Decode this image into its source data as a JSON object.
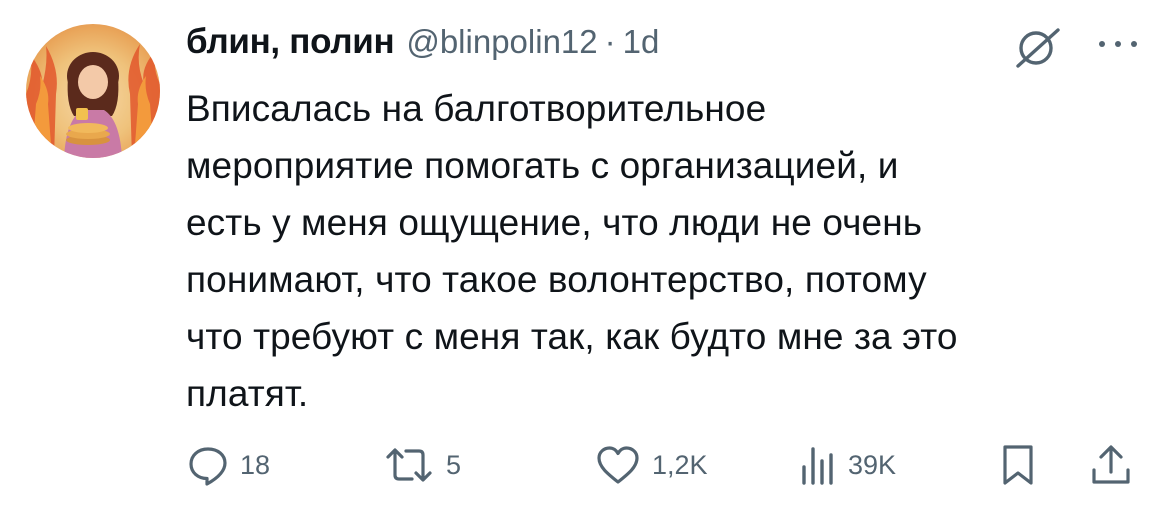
{
  "tweet": {
    "author": {
      "display_name": "блин, полин",
      "handle": "@blinpolin12",
      "avatar_icon": "avatar-illustration"
    },
    "separator": "·",
    "timestamp": "1d",
    "text": "Вписалась на балготворительное\nмероприятие помогать с организацией, и\nесть у меня ощущение, что люди не очень\nпонимают, что такое волонтерство, потому\nчто требуют с меня так, как будто мне за это\nплатят.",
    "actions": {
      "reply": {
        "icon": "reply-icon",
        "count": "18"
      },
      "retweet": {
        "icon": "retweet-icon",
        "count": "5"
      },
      "like": {
        "icon": "heart-icon",
        "count": "1,2K"
      },
      "views": {
        "icon": "views-icon",
        "count": "39K"
      },
      "bookmark": {
        "icon": "bookmark-icon"
      },
      "share": {
        "icon": "share-icon"
      }
    },
    "header_icons": [
      "grok-icon",
      "more-icon"
    ]
  },
  "colors": {
    "text_primary": "#0f1419",
    "text_secondary": "#536471",
    "background": "#ffffff"
  }
}
